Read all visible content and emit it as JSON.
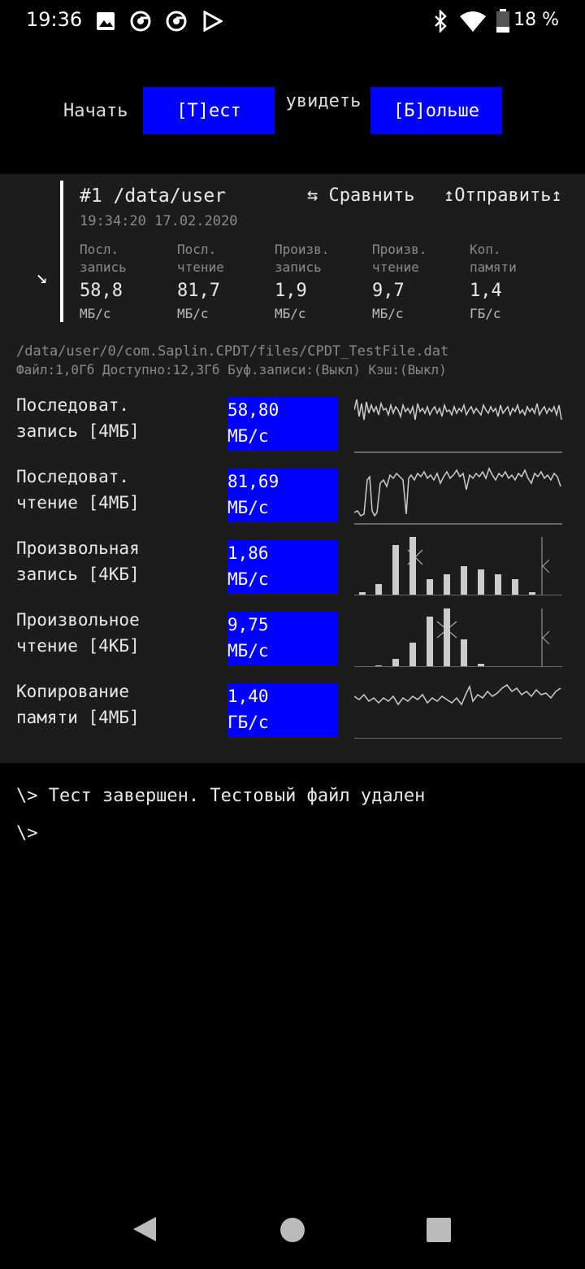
{
  "status_bar": {
    "time": "19:36",
    "battery": "18 %",
    "icons": [
      "image-icon",
      "chrome-icon",
      "chrome-icon",
      "play-store-icon",
      "bluetooth-icon",
      "wifi-icon",
      "battery-icon"
    ]
  },
  "controls": {
    "start_label": "Начать",
    "test_button": "[Т]ест",
    "see_label": "увидеть",
    "more_button": "[Б]ольше"
  },
  "result": {
    "title": "#1 /data/user",
    "date": "19:34:20 17.02.2020",
    "compare": "⇆ Сравнить",
    "send": "↥Отправить↥",
    "metrics": [
      {
        "label1": "Посл.",
        "label2": "запись",
        "value": "58,8",
        "unit": "МБ/с"
      },
      {
        "label1": "Посл.",
        "label2": "чтение",
        "value": "81,7",
        "unit": "МБ/с"
      },
      {
        "label1": "Произв.",
        "label2": "запись",
        "value": "1,9",
        "unit": "МБ/с"
      },
      {
        "label1": "Произв.",
        "label2": "чтение",
        "value": "9,7",
        "unit": "МБ/с"
      },
      {
        "label1": "Коп.",
        "label2": "памяти",
        "value": "1,4",
        "unit": "ГБ/с"
      }
    ]
  },
  "file": {
    "path": "/data/user/0/com.Saplin.CPDT/files/CPDT_TestFile.dat",
    "info": "Файл:1,0Гб Доступно:12,3Гб Буф.записи:(Выкл) Кэш:(Выкл)"
  },
  "rows": [
    {
      "name1": "Последоват.",
      "name2": "запись [4МБ]",
      "value": "58,80",
      "unit": "МБ/с"
    },
    {
      "name1": "Последоват.",
      "name2": "чтение [4МБ]",
      "value": "81,69",
      "unit": "МБ/с"
    },
    {
      "name1": "Произвольная",
      "name2": "запись [4КБ]",
      "value": "1,86",
      "unit": "МБ/с"
    },
    {
      "name1": "Произвольное",
      "name2": "чтение [4КБ]",
      "value": "9,75",
      "unit": "МБ/с"
    },
    {
      "name1": "Копирование",
      "name2": "памяти [4МБ]",
      "value": "1,40",
      "unit": "ГБ/с"
    }
  ],
  "console": {
    "line1": "\\> Тест завершен. Тестовый файл удален",
    "line2": "\\>"
  },
  "nav": {
    "icons": [
      "back-icon",
      "home-icon",
      "recents-icon"
    ]
  }
}
